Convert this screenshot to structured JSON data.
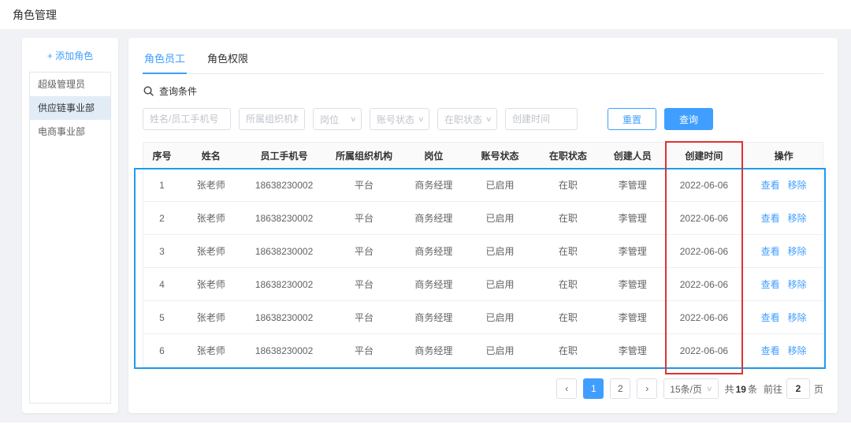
{
  "page": {
    "title": "角色管理"
  },
  "icons": {
    "chevron_down": "∨"
  },
  "sidebar": {
    "add_role": "+ 添加角色",
    "items": [
      {
        "label": "超级管理员",
        "active": false
      },
      {
        "label": "供应链事业部",
        "active": true
      },
      {
        "label": "电商事业部",
        "active": false
      }
    ]
  },
  "tabs": [
    {
      "label": "角色员工",
      "active": true
    },
    {
      "label": "角色权限",
      "active": false
    }
  ],
  "filters": {
    "section_title": "查询条件",
    "name_placeholder": "姓名/员工手机号",
    "org_placeholder": "所属组织机构",
    "position_placeholder": "岗位",
    "account_status_placeholder": "账号状态",
    "employment_status_placeholder": "在职状态",
    "create_time_placeholder": "创建时间",
    "reset_label": "重置",
    "query_label": "查询"
  },
  "table": {
    "headers": [
      "序号",
      "姓名",
      "员工手机号",
      "所属组织机构",
      "岗位",
      "账号状态",
      "在职状态",
      "创建人员",
      "创建时间",
      "操作"
    ],
    "actions": {
      "view": "查看",
      "remove": "移除"
    },
    "rows": [
      {
        "no": "1",
        "name": "张老师",
        "phone": "18638230002",
        "org": "平台",
        "position": "商务经理",
        "account_status": "已启用",
        "employment_status": "在职",
        "creator": "李管理",
        "create_time": "2022-06-06"
      },
      {
        "no": "2",
        "name": "张老师",
        "phone": "18638230002",
        "org": "平台",
        "position": "商务经理",
        "account_status": "已启用",
        "employment_status": "在职",
        "creator": "李管理",
        "create_time": "2022-06-06"
      },
      {
        "no": "3",
        "name": "张老师",
        "phone": "18638230002",
        "org": "平台",
        "position": "商务经理",
        "account_status": "已启用",
        "employment_status": "在职",
        "creator": "李管理",
        "create_time": "2022-06-06"
      },
      {
        "no": "4",
        "name": "张老师",
        "phone": "18638230002",
        "org": "平台",
        "position": "商务经理",
        "account_status": "已启用",
        "employment_status": "在职",
        "creator": "李管理",
        "create_time": "2022-06-06"
      },
      {
        "no": "5",
        "name": "张老师",
        "phone": "18638230002",
        "org": "平台",
        "position": "商务经理",
        "account_status": "已启用",
        "employment_status": "在职",
        "creator": "李管理",
        "create_time": "2022-06-06"
      },
      {
        "no": "6",
        "name": "张老师",
        "phone": "18638230002",
        "org": "平台",
        "position": "商务经理",
        "account_status": "已启用",
        "employment_status": "在职",
        "creator": "李管理",
        "create_time": "2022-06-06"
      }
    ]
  },
  "pagination": {
    "prev_label": "‹",
    "next_label": "›",
    "pages": [
      {
        "label": "1",
        "active": true
      },
      {
        "label": "2",
        "active": false
      }
    ],
    "page_size_label": "15条/页",
    "total_prefix": "共",
    "total_count": "19",
    "total_suffix": "条",
    "jump_prefix": "前往",
    "jump_value": "2",
    "jump_suffix": "页"
  },
  "annotations": {
    "row_box_color": "#1f9bef",
    "column_box_color": "#e03232"
  }
}
